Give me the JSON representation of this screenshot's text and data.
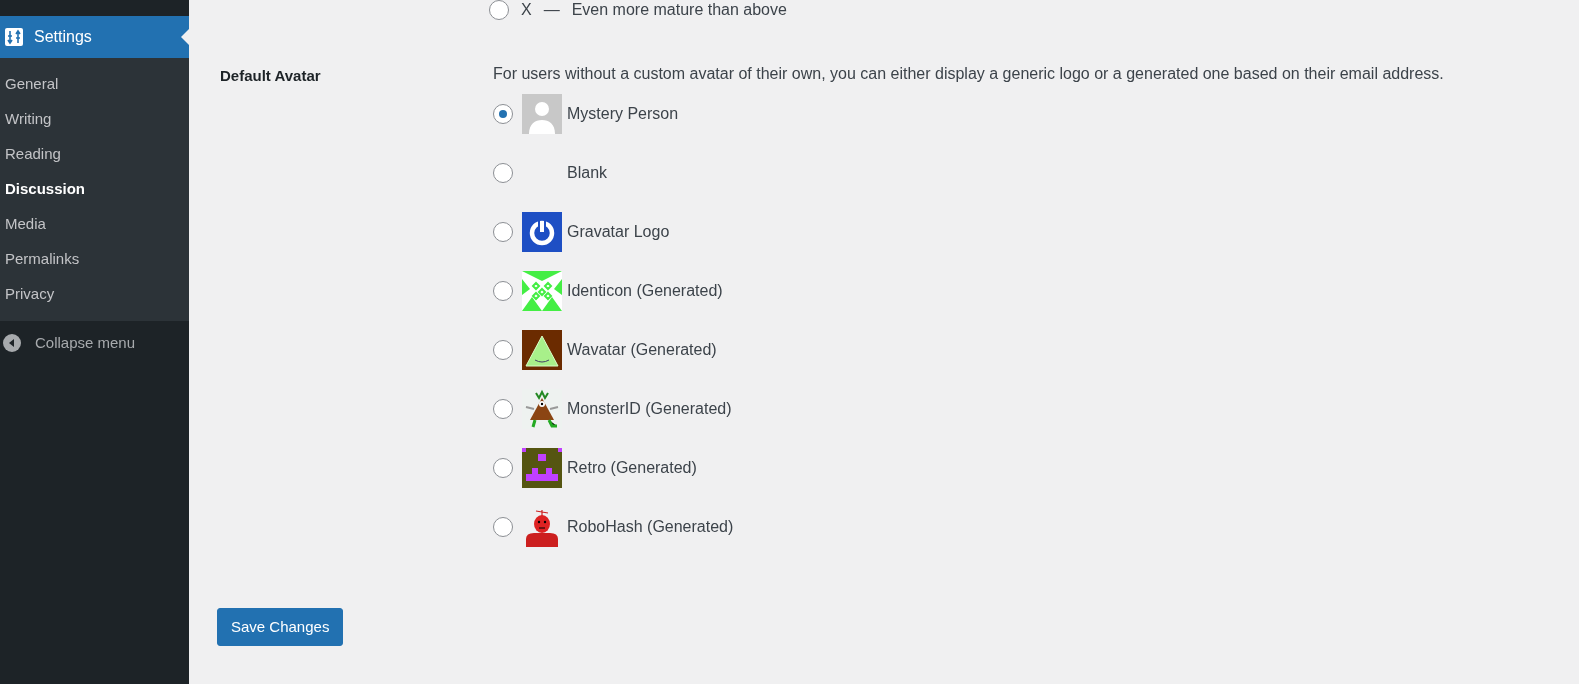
{
  "sidebar": {
    "current": {
      "label": "Settings"
    },
    "items": [
      {
        "label": "General",
        "selected": false
      },
      {
        "label": "Writing",
        "selected": false
      },
      {
        "label": "Reading",
        "selected": false
      },
      {
        "label": "Discussion",
        "selected": true
      },
      {
        "label": "Media",
        "selected": false
      },
      {
        "label": "Permalinks",
        "selected": false
      },
      {
        "label": "Privacy",
        "selected": false
      }
    ],
    "collapse": {
      "label": "Collapse menu"
    }
  },
  "rating_option": {
    "code": "X",
    "dash": "—",
    "text": "Even more mature than above",
    "selected": false
  },
  "default_avatar": {
    "label": "Default Avatar",
    "description": "For users without a custom avatar of their own, you can either display a generic logo or a generated one based on their email address.",
    "options": [
      {
        "kind": "mystery",
        "label": "Mystery Person",
        "selected": true
      },
      {
        "kind": "blank",
        "label": "Blank",
        "selected": false
      },
      {
        "kind": "gravatar",
        "label": "Gravatar Logo",
        "selected": false
      },
      {
        "kind": "identicon",
        "label": "Identicon (Generated)",
        "selected": false
      },
      {
        "kind": "wavatar",
        "label": "Wavatar (Generated)",
        "selected": false
      },
      {
        "kind": "monster",
        "label": "MonsterID (Generated)",
        "selected": false
      },
      {
        "kind": "retro",
        "label": "Retro (Generated)",
        "selected": false
      },
      {
        "kind": "robohash",
        "label": "RoboHash (Generated)",
        "selected": false
      }
    ]
  },
  "save_button": {
    "label": "Save Changes"
  }
}
